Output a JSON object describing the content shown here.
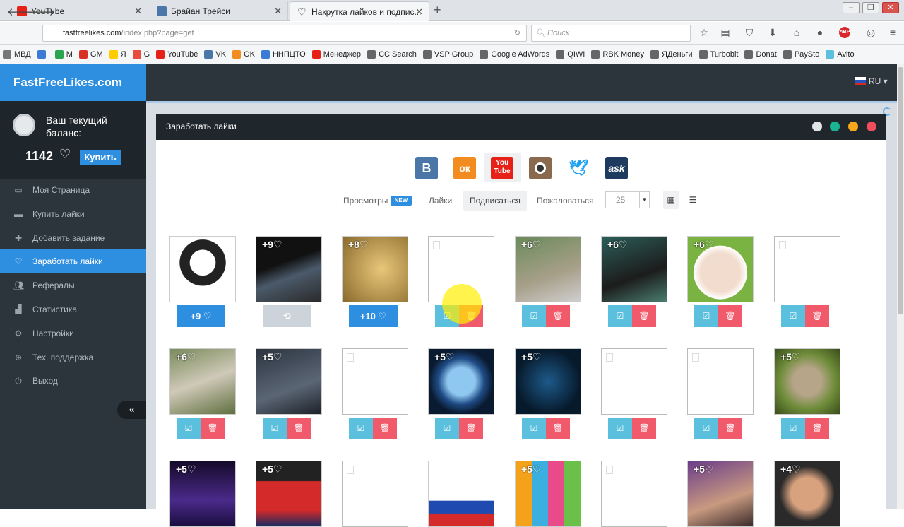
{
  "browser": {
    "tabs": [
      {
        "title": "YouTube",
        "icon": "youtube-icon",
        "color": "#e62117"
      },
      {
        "title": "Брайан Трейси",
        "icon": "vk-icon",
        "color": "#4a76a8"
      },
      {
        "title": "Накрутка лайков и подпис...",
        "icon": "heart-icon",
        "color": "#222222"
      }
    ],
    "url_host": "fastfreelikes.com",
    "url_path": "/index.php?page=get",
    "search_placeholder": "Поиск",
    "bookmarks": [
      {
        "label": "МВД",
        "color": "#777"
      },
      {
        "label": "",
        "color": "#3a7bd5"
      },
      {
        "label": "M",
        "color": "#2aa44f"
      },
      {
        "label": "GM",
        "color": "#d93025"
      },
      {
        "label": "Я",
        "color": "#ffcc00"
      },
      {
        "label": "G",
        "color": "#e74c3c"
      },
      {
        "label": "YouTube",
        "color": "#e62117"
      },
      {
        "label": "VK",
        "color": "#4a76a8"
      },
      {
        "label": "OK",
        "color": "#f28c1e"
      },
      {
        "label": "ННПЦТО",
        "color": "#3a7bd5"
      },
      {
        "label": "Менеджер",
        "color": "#e62117"
      },
      {
        "label": "CC Search",
        "color": "#666"
      },
      {
        "label": "VSP Group",
        "color": "#666"
      },
      {
        "label": "Google AdWords",
        "color": "#666"
      },
      {
        "label": "QIWI",
        "color": "#666"
      },
      {
        "label": "RBK Money",
        "color": "#666"
      },
      {
        "label": "ЯДеньги",
        "color": "#666"
      },
      {
        "label": "Turbobit",
        "color": "#666"
      },
      {
        "label": "Donat",
        "color": "#666"
      },
      {
        "label": "PaySto",
        "color": "#666"
      },
      {
        "label": "Avito",
        "color": "#5bc0de"
      }
    ]
  },
  "site": {
    "brand": "FastFreeLikes.com",
    "balance_title": "Ваш текущий баланс:",
    "balance": "1142",
    "buy_label": "Купить",
    "lang": "RU",
    "menu": [
      {
        "label": "Моя Страница",
        "icon": "monitor-icon",
        "active": false
      },
      {
        "label": "Купить лайки",
        "icon": "card-icon",
        "active": false
      },
      {
        "label": "Добавить задание",
        "icon": "plus-icon",
        "active": false
      },
      {
        "label": "Заработать лайки",
        "icon": "heart-icon",
        "active": true
      },
      {
        "label": "Рефералы",
        "icon": "users-icon",
        "active": false
      },
      {
        "label": "Статистика",
        "icon": "chart-icon",
        "active": false
      },
      {
        "label": "Настройки",
        "icon": "gear-icon",
        "active": false
      },
      {
        "label": "Тех. поддержка",
        "icon": "globe-icon",
        "active": false
      },
      {
        "label": "Выход",
        "icon": "power-icon",
        "active": false
      }
    ],
    "panel_title": "Заработать лайки",
    "social": [
      {
        "label": "В",
        "icon": "vk-icon",
        "color": "#4a76a8"
      },
      {
        "label": "ок",
        "icon": "odnoklassniki-icon",
        "color": "#f28c1e"
      },
      {
        "label": "You Tube",
        "icon": "youtube-icon",
        "color": "#e62117"
      },
      {
        "label": "",
        "icon": "instagram-icon",
        "color": "#8a6a4f"
      },
      {
        "label": "",
        "icon": "twitter-icon",
        "color": "#1da1f2"
      },
      {
        "label": "ask",
        "icon": "ask-icon",
        "color": "#1e3a5f"
      }
    ],
    "filters": {
      "views": "Просмотры",
      "new_badge": "NEW",
      "likes": "Лайки",
      "subscribe": "Подписаться",
      "report": "Пожаловаться",
      "per_page": "25"
    },
    "cards": [
      {
        "points": "",
        "btn": "+9",
        "type": "wide",
        "img": "skull"
      },
      {
        "points": "+9",
        "btn": "",
        "type": "gray",
        "img": "dark"
      },
      {
        "points": "+8",
        "btn": "+10",
        "type": "wide",
        "img": "gold"
      },
      {
        "points": "",
        "btn": "",
        "type": "pair",
        "img": "empty"
      },
      {
        "points": "+6",
        "btn": "",
        "type": "pair",
        "img": "green"
      },
      {
        "points": "+6",
        "btn": "",
        "type": "pair",
        "img": "teal"
      },
      {
        "points": "+6",
        "btn": "",
        "type": "pair",
        "img": "face"
      },
      {
        "points": "",
        "btn": "",
        "type": "pair",
        "img": "empty"
      },
      {
        "points": "+6",
        "btn": "",
        "type": "pair",
        "img": "wolf"
      },
      {
        "points": "+5",
        "btn": "",
        "type": "pair",
        "img": "bat"
      },
      {
        "points": "",
        "btn": "",
        "type": "pair",
        "img": "empty"
      },
      {
        "points": "+5",
        "btn": "",
        "type": "pair",
        "img": "fist"
      },
      {
        "points": "+5",
        "btn": "",
        "type": "pair",
        "img": "kodi"
      },
      {
        "points": "",
        "btn": "",
        "type": "pair",
        "img": "empty"
      },
      {
        "points": "",
        "btn": "",
        "type": "pair",
        "img": "empty"
      },
      {
        "points": "+5",
        "btn": "",
        "type": "pair",
        "img": "owl"
      },
      {
        "points": "+5",
        "btn": "",
        "type": "none",
        "img": "purple"
      },
      {
        "points": "+5",
        "btn": "",
        "type": "none",
        "img": "thumb"
      },
      {
        "points": "",
        "btn": "",
        "type": "none",
        "img": "empty"
      },
      {
        "points": "",
        "btn": "",
        "type": "none",
        "img": "flag"
      },
      {
        "points": "+5",
        "btn": "",
        "type": "none",
        "img": "cartoon"
      },
      {
        "points": "",
        "btn": "",
        "type": "none",
        "img": "empty"
      },
      {
        "points": "+5",
        "btn": "",
        "type": "none",
        "img": "man"
      },
      {
        "points": "+4",
        "btn": "",
        "type": "none",
        "img": "glasses"
      }
    ]
  }
}
